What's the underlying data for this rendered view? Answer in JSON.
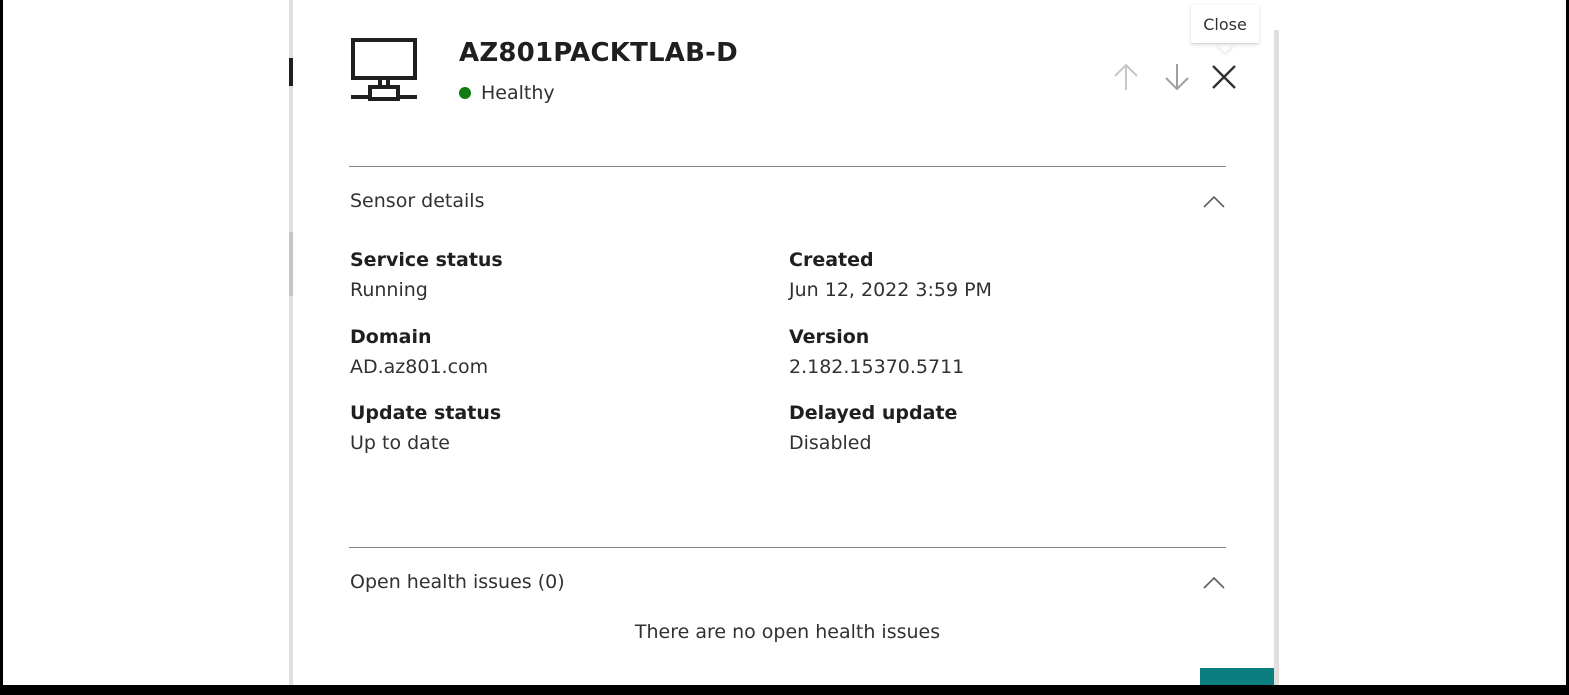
{
  "header": {
    "title": "AZ801PACKTLAB-D",
    "status": "Healthy",
    "status_color": "#107c10",
    "device_icon": "network-computer-icon"
  },
  "toolbar": {
    "up_icon": "arrow-up-icon",
    "down_icon": "arrow-down-icon",
    "close_icon": "close-icon",
    "close_tooltip": "Close"
  },
  "sensor_details": {
    "title": "Sensor details",
    "fields": [
      {
        "label": "Service status",
        "value": "Running"
      },
      {
        "label": "Created",
        "value": "Jun 12, 2022 3:59 PM"
      },
      {
        "label": "Domain",
        "value": "AD.az801.com"
      },
      {
        "label": "Version",
        "value": "2.182.15370.5711"
      },
      {
        "label": "Update status",
        "value": "Up to date"
      },
      {
        "label": "Delayed update",
        "value": "Disabled"
      }
    ]
  },
  "health_issues": {
    "title": "Open health issues (0)",
    "empty_message": "There are no open health issues"
  },
  "colors": {
    "accent": "#0b7f80",
    "text": "#323130",
    "divider": "#8a8886"
  }
}
